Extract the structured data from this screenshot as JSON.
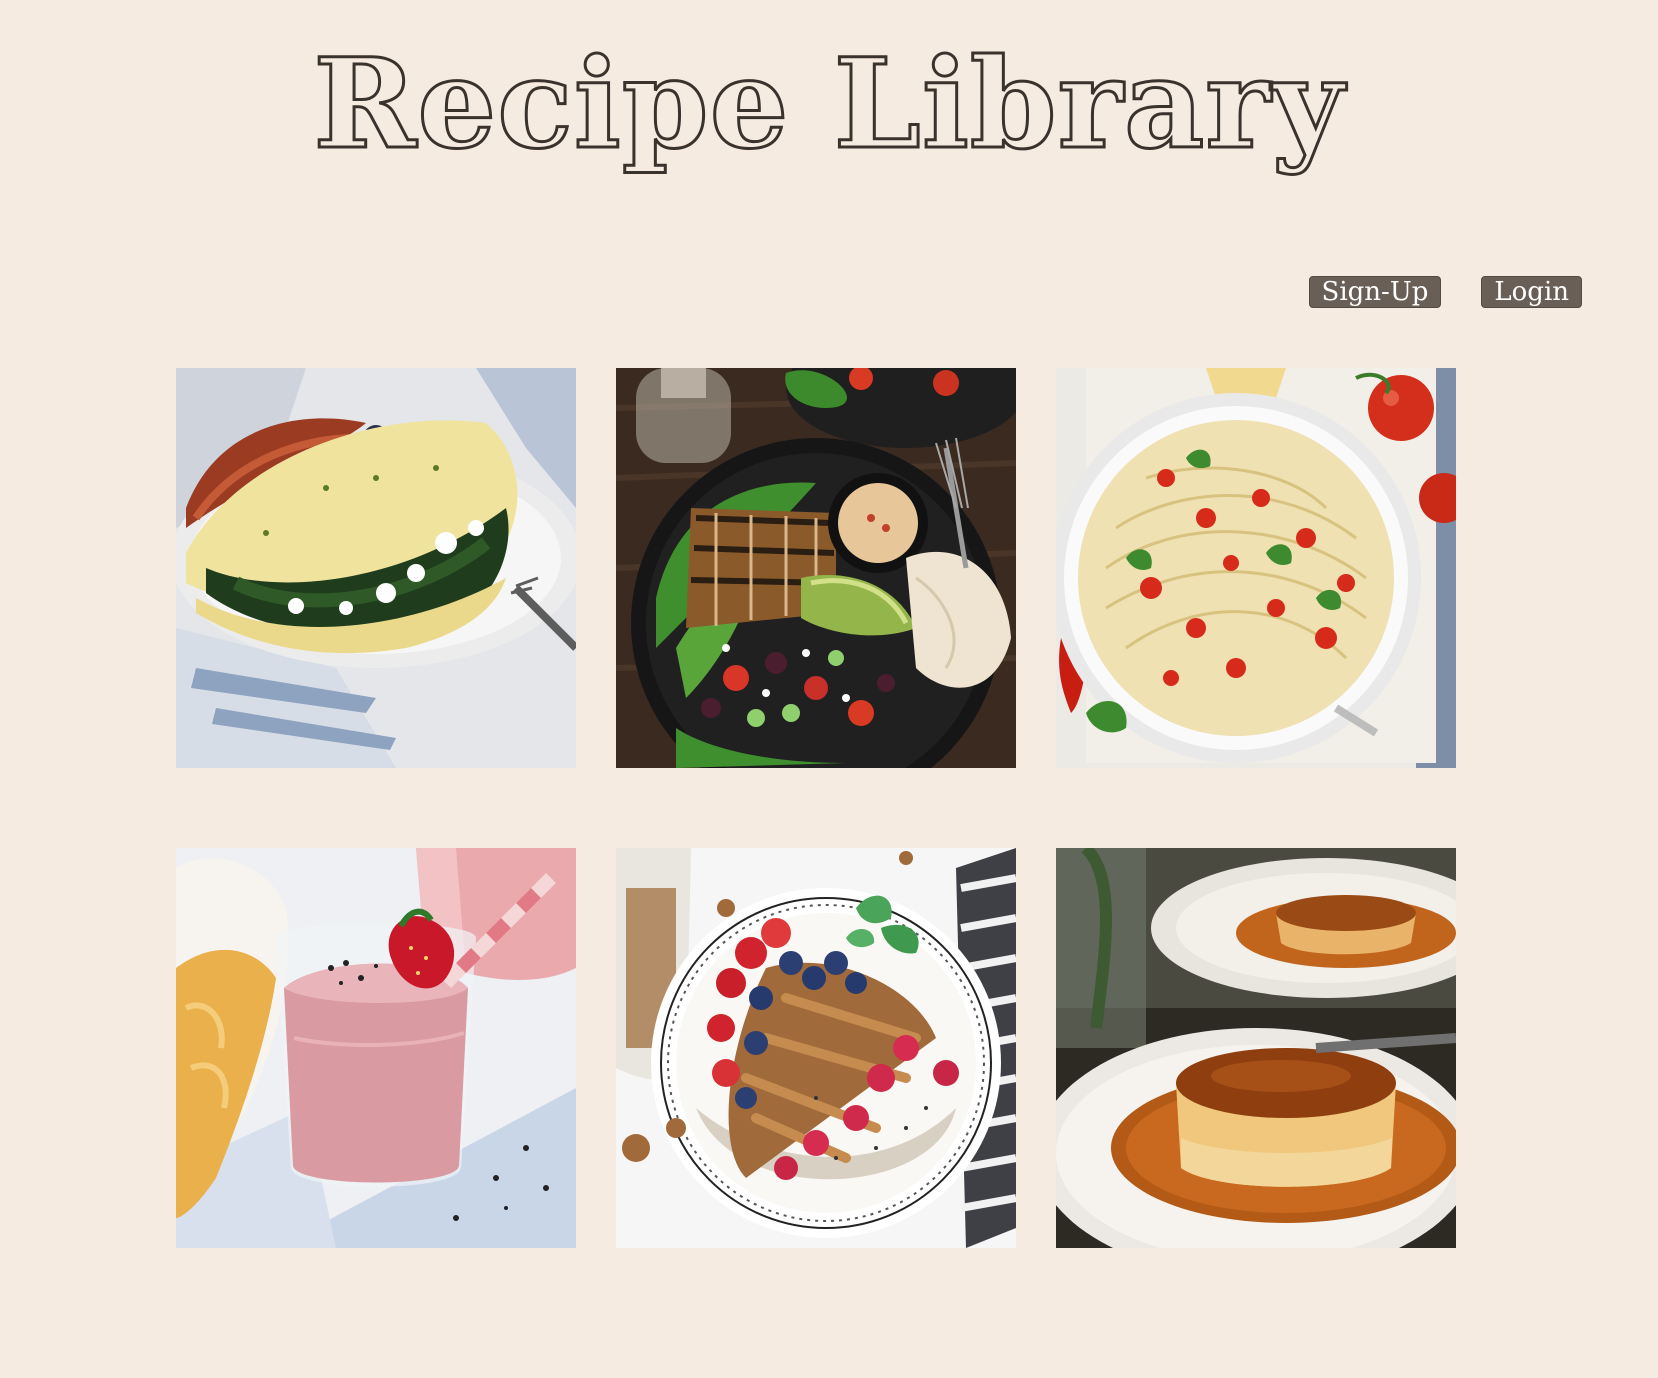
{
  "header": {
    "title": "Recipe Library"
  },
  "nav": {
    "signup_label": "Sign-Up",
    "login_label": "Login"
  },
  "recipes": [
    {
      "image": "spinach-feta-omelette-image"
    },
    {
      "image": "grilled-chicken-salad-bowl-image"
    },
    {
      "image": "tomato-spaghetti-pan-image"
    },
    {
      "image": "strawberry-smoothie-image"
    },
    {
      "image": "berry-granola-yogurt-bowl-image"
    },
    {
      "image": "caramel-flan-image"
    }
  ],
  "colors": {
    "background": "#f5ebe1",
    "title_outline": "#3a332d",
    "button_background": "#6a5f56",
    "button_text": "#ffffff"
  }
}
